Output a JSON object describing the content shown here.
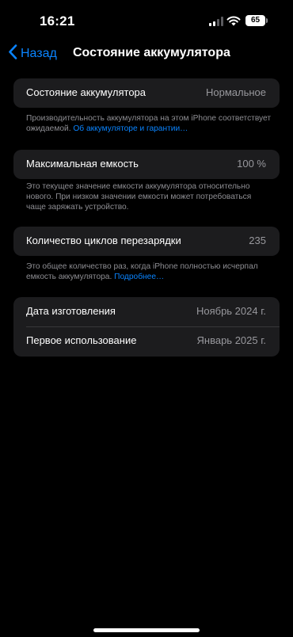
{
  "status_bar": {
    "time": "16:21",
    "battery_level": "65",
    "signal_bars_active": 2,
    "signal_bars_total": 4
  },
  "nav": {
    "back_label": "Назад",
    "title": "Состояние аккумулятора"
  },
  "health": {
    "label": "Состояние аккумулятора",
    "value": "Нормальное",
    "footer_text": "Производительность аккумулятора на этом iPhone соответствует ожидаемой.",
    "footer_link": "Об аккумуляторе и гарантии…"
  },
  "capacity": {
    "label": "Максимальная емкость",
    "value": "100 %",
    "footer_text": "Это текущее значение емкости аккумулятора относительно нового. При низком значении емкости может потребоваться чаще заряжать устройство."
  },
  "cycles": {
    "label": "Количество циклов перезарядки",
    "value": "235",
    "footer_text": "Это общее количество раз, когда iPhone полностью исчерпал емкость аккумулятора.",
    "footer_link": "Подробнее…"
  },
  "dates": {
    "manufacture_label": "Дата изготовления",
    "manufacture_value": "Ноябрь 2024 г.",
    "first_use_label": "Первое использование",
    "first_use_value": "Январь 2025 г."
  },
  "colors": {
    "background": "#000000",
    "cell_background": "#1c1c1e",
    "accent": "#0a84ff",
    "secondary_text": "#98989d"
  }
}
